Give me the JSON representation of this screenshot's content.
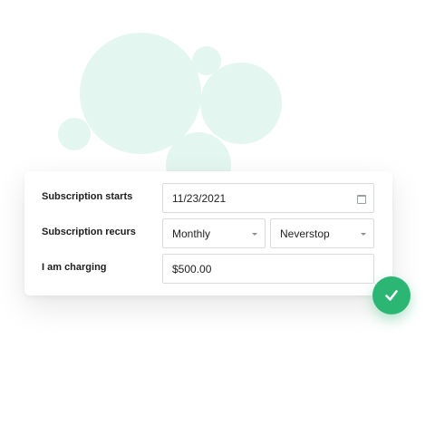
{
  "form": {
    "start_label": "Subscription starts",
    "start_date": "11/23/2021",
    "recurs_label": "Subscription recurs",
    "frequency": "Monthly",
    "end_option": "Neverstop",
    "charging_label": "I am charging",
    "amount": "$500.00"
  },
  "icons": {
    "calendar": "calendar-icon",
    "caret": "chevron-down-icon",
    "check": "checkmark-icon"
  },
  "colors": {
    "bubble": "#e3f6ef",
    "accent": "#2bb673"
  }
}
